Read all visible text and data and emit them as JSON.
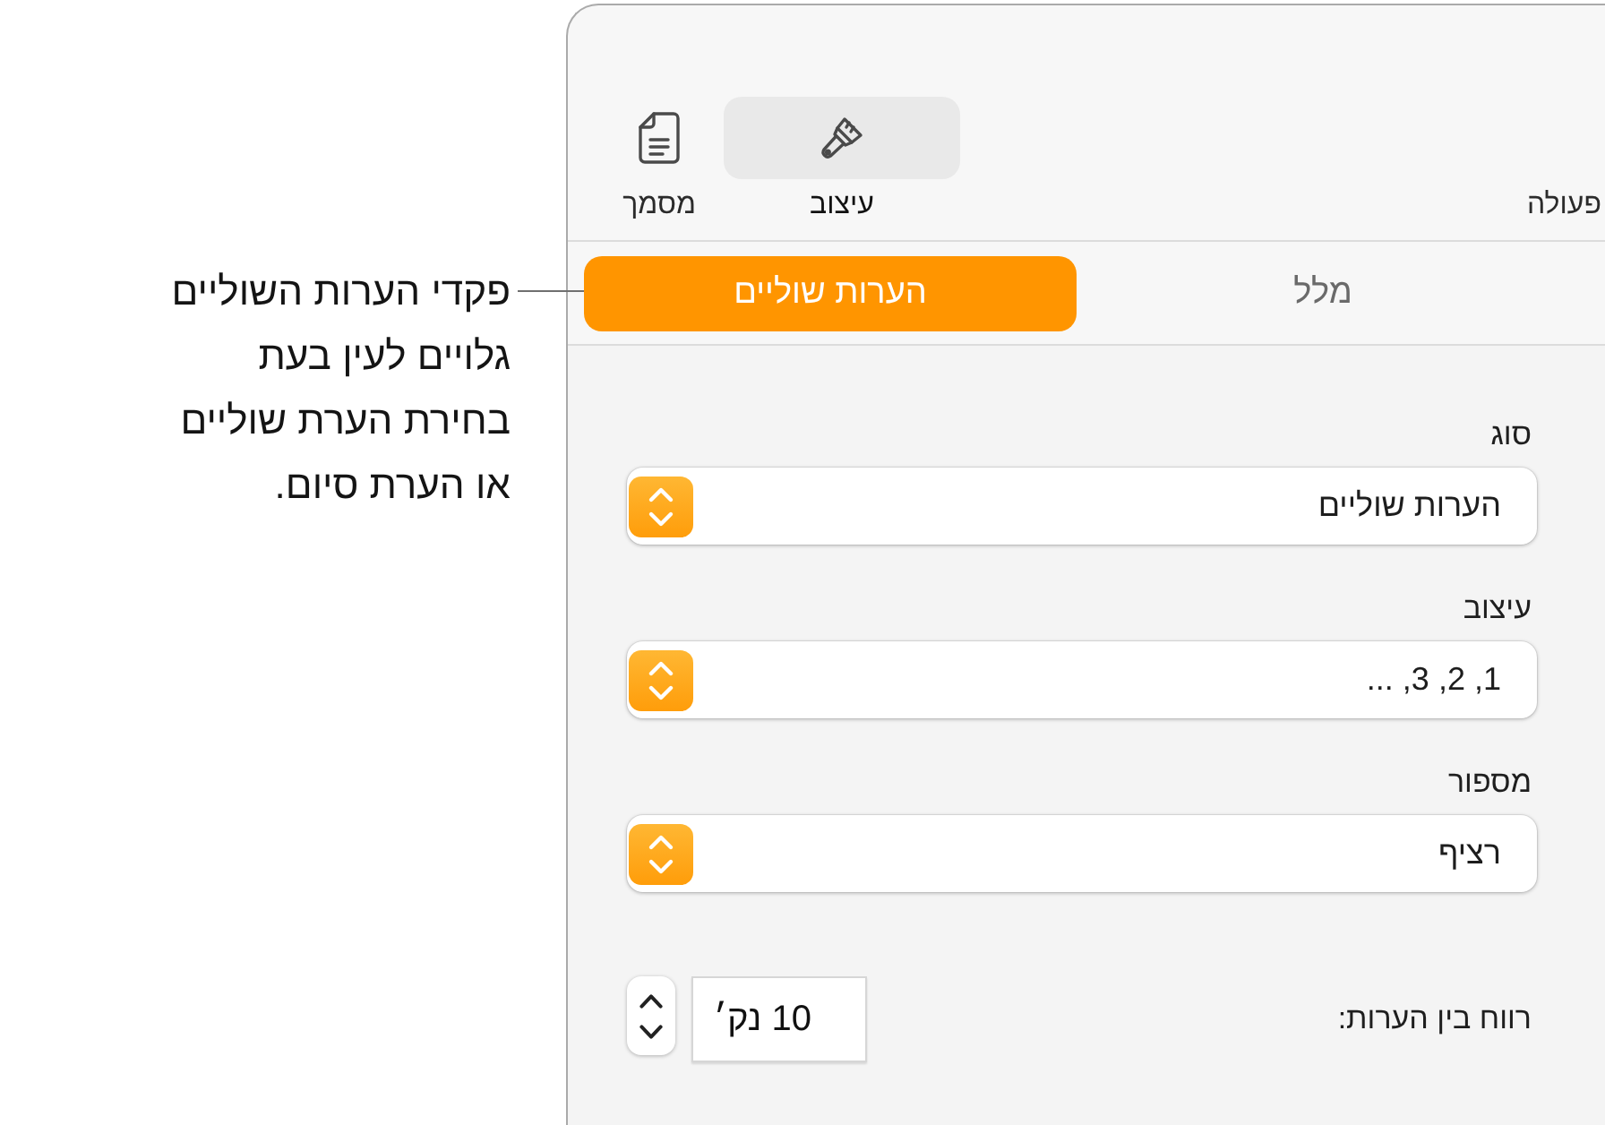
{
  "callout": {
    "text": "פקדי הערות השוליים\nגלויים לעין בעת\nבחירת הערת שוליים\nאו הערת סיום."
  },
  "toolbar": {
    "items": [
      {
        "kind": "label",
        "label": "פעולה",
        "selected": false
      },
      {
        "kind": "brush",
        "label": "עיצוב",
        "selected": true
      },
      {
        "kind": "document",
        "label": "מסמך",
        "selected": false
      }
    ]
  },
  "tabs": [
    {
      "label": "מלל",
      "selected": false
    },
    {
      "label": "הערות שוליים",
      "selected": true
    }
  ],
  "fields": [
    {
      "label": "סוג",
      "value": "הערות שוליים"
    },
    {
      "label": "עיצוב",
      "value": "1, 2, 3, ..."
    },
    {
      "label": "מספור",
      "value": "רציף"
    }
  ],
  "spacing": {
    "label": "רווח בין הערות:",
    "value": "10 נק׳"
  }
}
